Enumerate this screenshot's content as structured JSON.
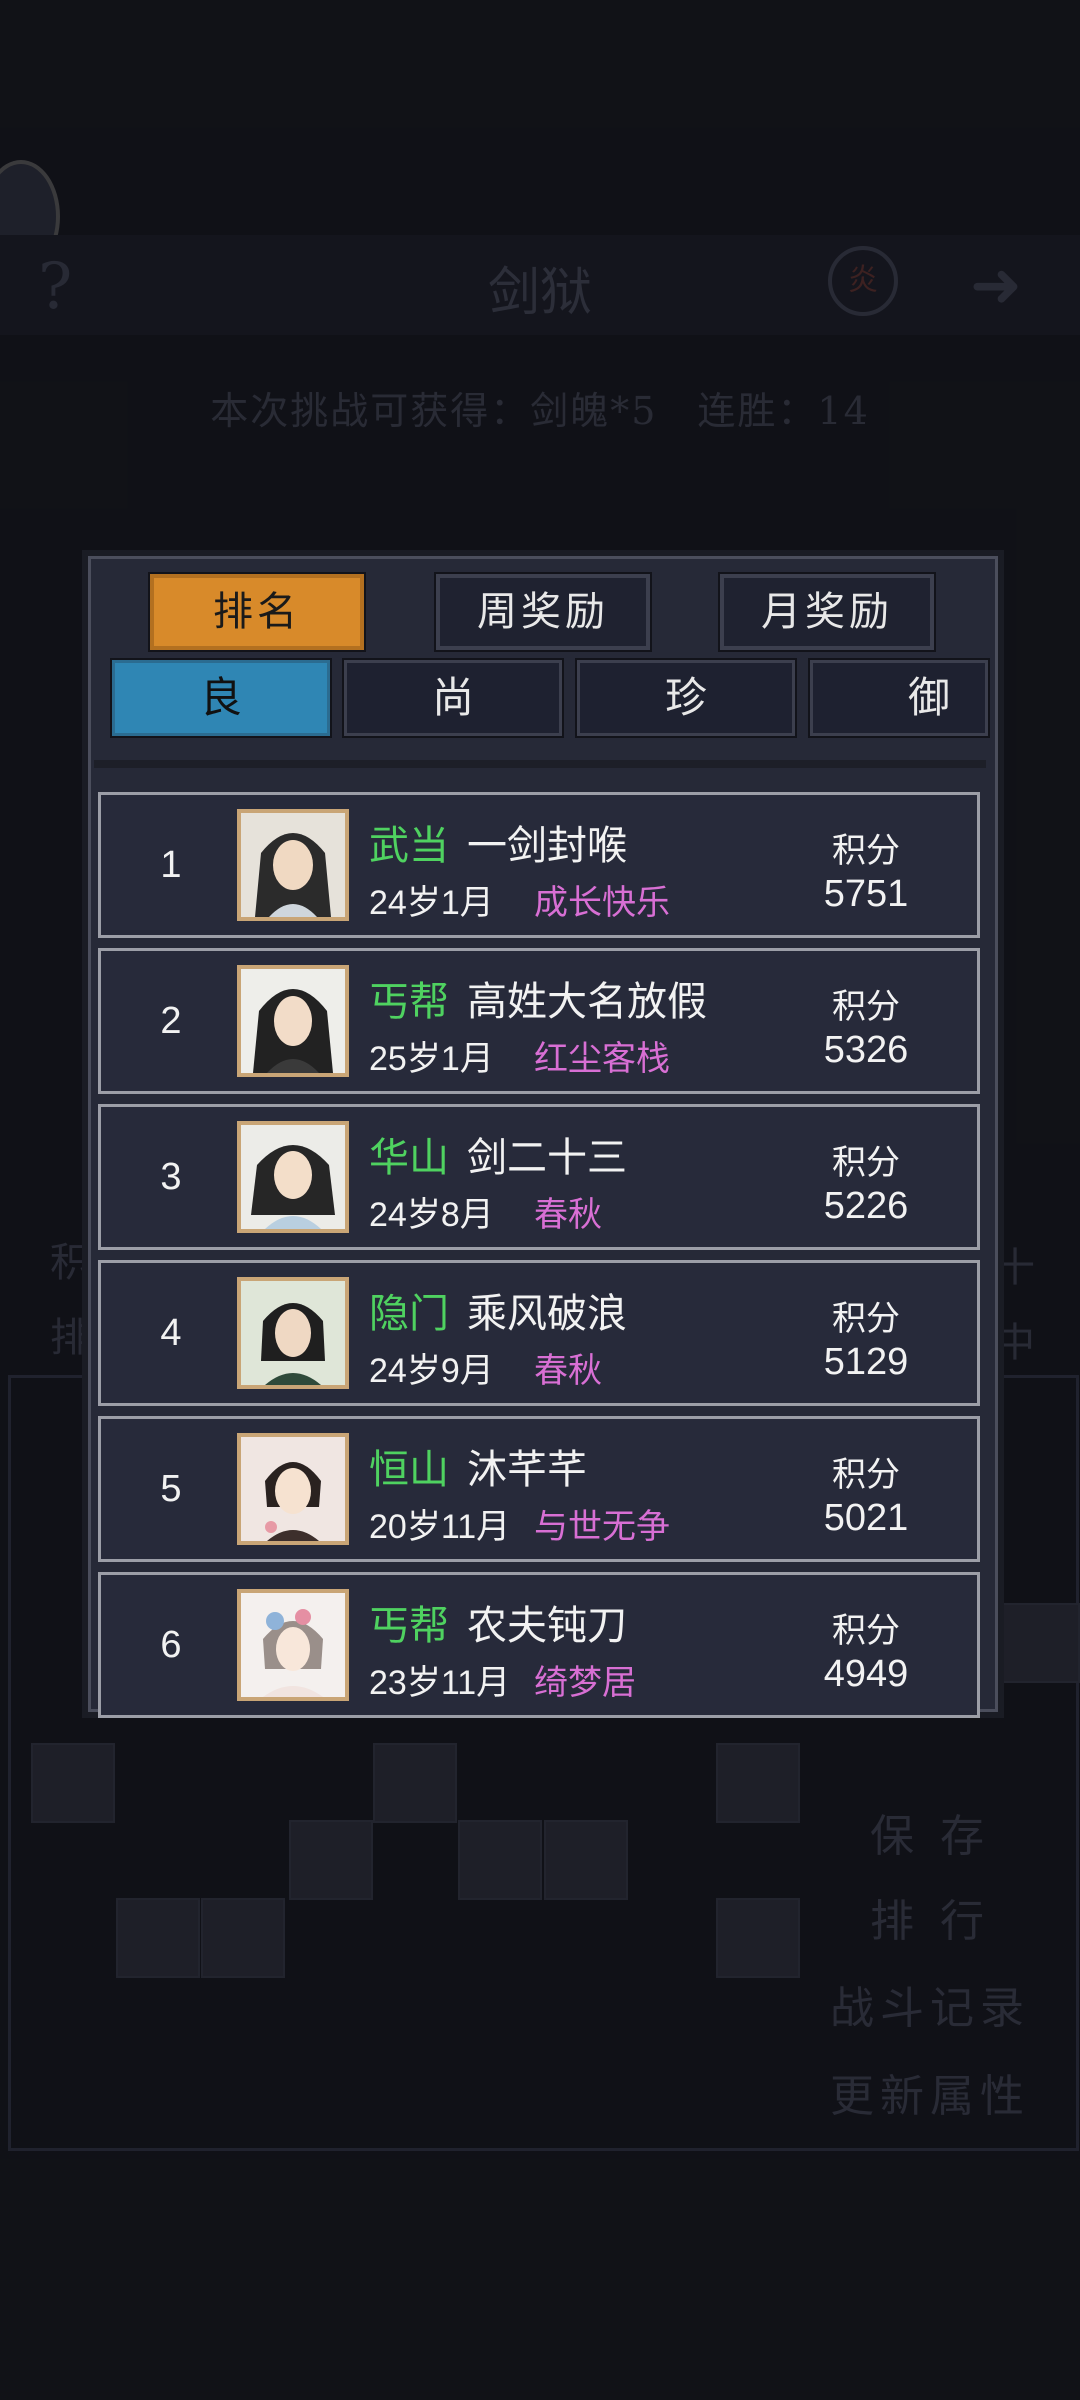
{
  "background": {
    "title": "剑狱",
    "help": "?",
    "seal": "炎",
    "arrow": "➜",
    "subtitle": "本次挑战可获得：剑魄*5　连胜：14",
    "side_left_1": "积",
    "side_left_2": "排",
    "side_right_1": "十",
    "side_right_2": "中",
    "buttons": [
      "保 存",
      "排 行",
      "战斗记录",
      "更新属性"
    ]
  },
  "tabs_top": [
    {
      "label": "排名",
      "active": true
    },
    {
      "label": "周奖励",
      "active": false
    },
    {
      "label": "月奖励",
      "active": false
    }
  ],
  "tabs_tier": [
    {
      "label": "良",
      "active": true
    },
    {
      "label": "尚",
      "active": false
    },
    {
      "label": "珍",
      "active": false
    },
    {
      "label": "御",
      "active": false
    }
  ],
  "score_label": "积分",
  "colors": {
    "sect": "#4fd260",
    "guild": "#d86fd4",
    "tab_active": "#d88a2a",
    "tier_active": "#2f86b4"
  },
  "rankings": [
    {
      "rank": "1",
      "sect": "武当",
      "name": "一剑封喉",
      "age": "24岁1月",
      "guild": "成长快乐",
      "score": "5751"
    },
    {
      "rank": "2",
      "sect": "丐帮",
      "name": "高姓大名放假",
      "age": "25岁1月",
      "guild": "红尘客栈",
      "score": "5326"
    },
    {
      "rank": "3",
      "sect": "华山",
      "name": "剑二十三",
      "age": "24岁8月",
      "guild": "春秋",
      "score": "5226"
    },
    {
      "rank": "4",
      "sect": "隐门",
      "name": "乘风破浪",
      "age": "24岁9月",
      "guild": "春秋",
      "score": "5129"
    },
    {
      "rank": "5",
      "sect": "恒山",
      "name": "沐芊芊",
      "age": "20岁11月",
      "guild": "与世无争",
      "score": "5021"
    },
    {
      "rank": "6",
      "sect": "丐帮",
      "name": "农夫钝刀",
      "age": "23岁11月",
      "guild": "绮梦居",
      "score": "4949"
    }
  ]
}
